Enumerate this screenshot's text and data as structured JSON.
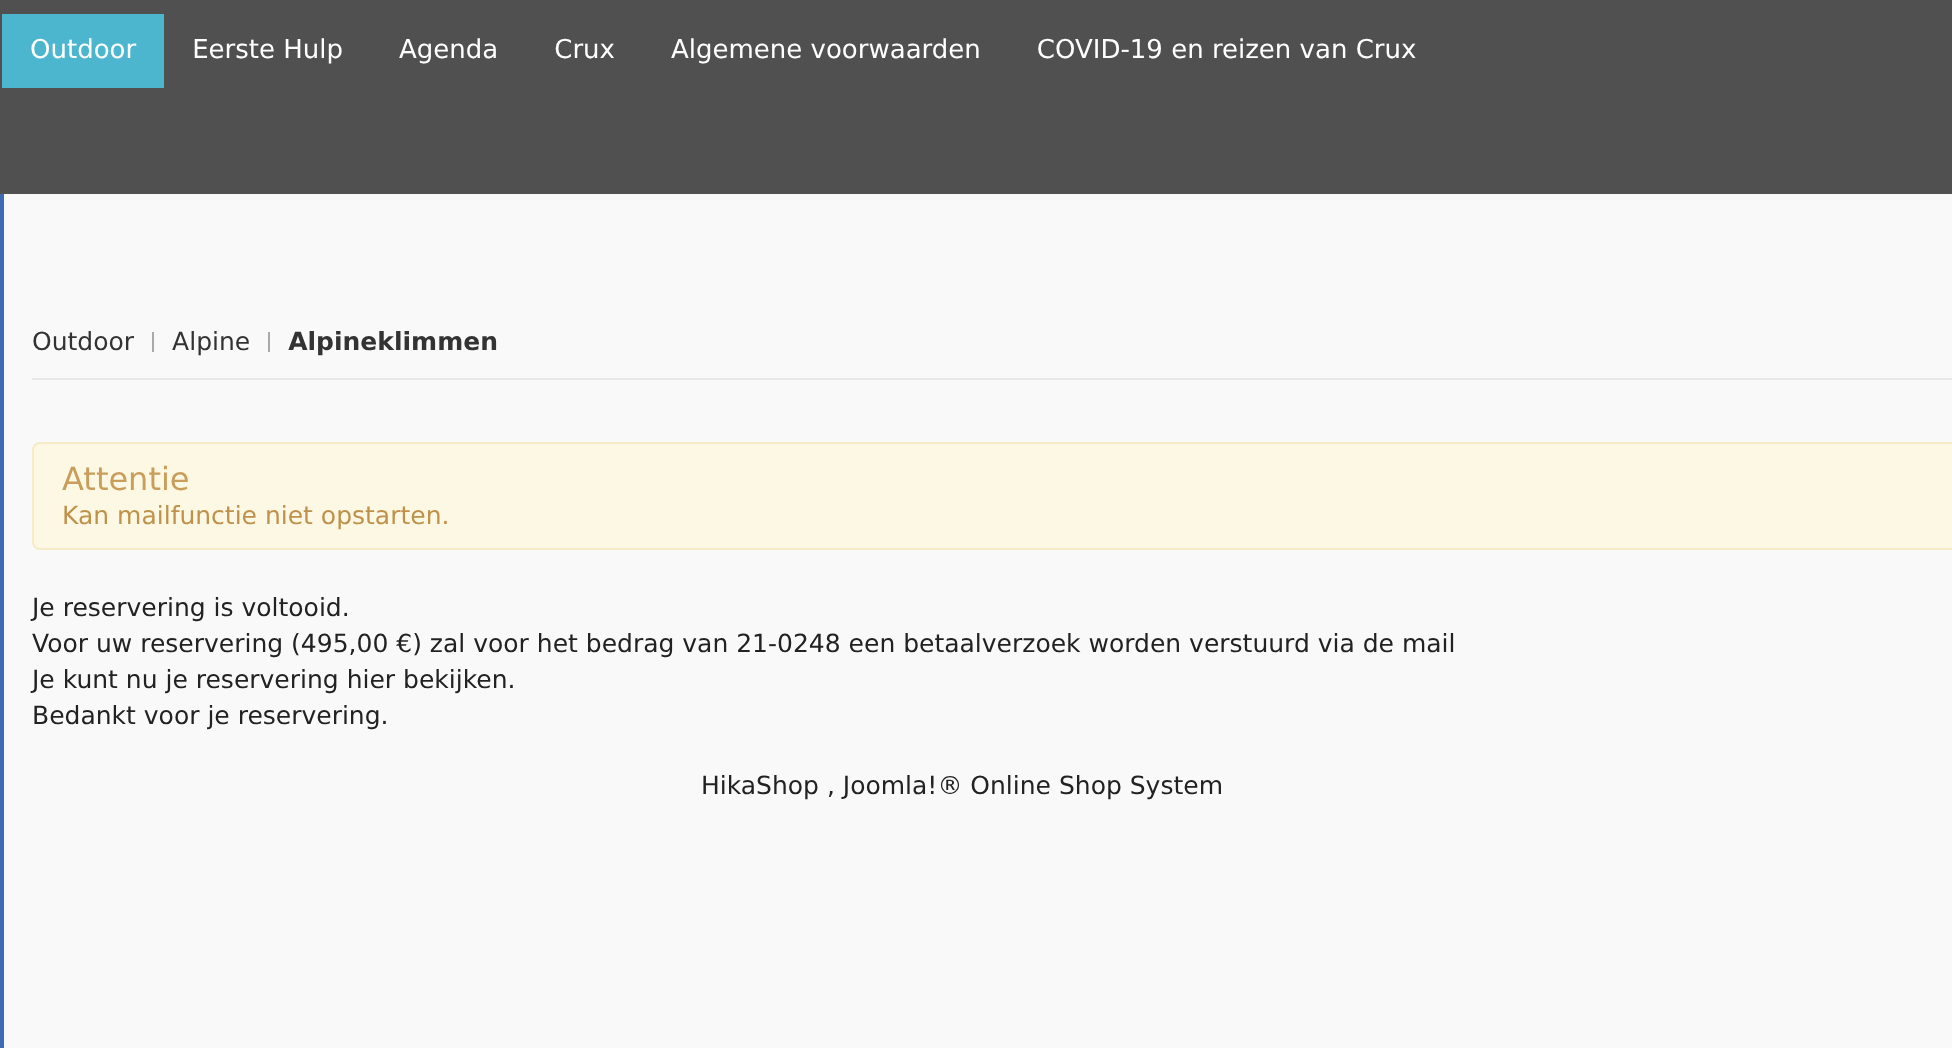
{
  "nav": [
    {
      "label": "Outdoor",
      "selected": true
    },
    {
      "label": "Eerste Hulp",
      "selected": false
    },
    {
      "label": "Agenda",
      "selected": false
    },
    {
      "label": "Crux",
      "selected": false
    },
    {
      "label": "Algemene voorwaarden",
      "selected": false
    },
    {
      "label": "COVID-19 en reizen van Crux",
      "selected": false
    }
  ],
  "breadcrumb": [
    {
      "label": "Outdoor",
      "current": false
    },
    {
      "label": "Alpine",
      "current": false
    },
    {
      "label": "Alpineklimmen",
      "current": true
    }
  ],
  "alert": {
    "title": "Attentie",
    "message": "Kan mailfunctie niet opstarten."
  },
  "messages": [
    {
      "text": "Je reservering is voltooid."
    },
    {
      "text": "Voor uw reservering (495,00 €) zal voor het bedrag van 21-0248 een betaalverzoek worden verstuurd via de mail"
    },
    {
      "before": "Je kunt nu je reservering ",
      "link": "hier",
      "after": " bekijken."
    },
    {
      "text": "Bedankt voor je reservering."
    }
  ],
  "footer": "HikaShop , Joomla!® Online Shop System"
}
